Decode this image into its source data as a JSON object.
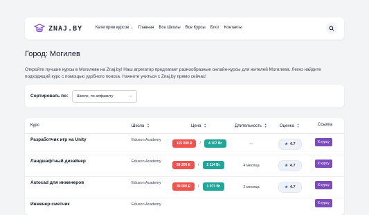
{
  "header": {
    "logo_text": "ZNAJ.BY",
    "nav": [
      {
        "label": "Категории курсов",
        "dropdown": true
      },
      {
        "label": "Главная"
      },
      {
        "label": "Все Школы"
      },
      {
        "label": "Все Курсы"
      },
      {
        "label": "Блог"
      },
      {
        "label": "Контакты"
      }
    ],
    "search_icon": "search-icon"
  },
  "page": {
    "title": "Город: Могилев",
    "intro": "Откройте лучшие курсы в Могилеве на Znaj.by! Наш агрегатор предлагает разнообразные онлайн-курсы для жителей Могилева. Легко найдите подходящий курс с помощью удобного поиска. Начните учиться с Znaj.by прямо сейчас!"
  },
  "sort": {
    "label": "Сортировать по:",
    "selected": "Школе, по алфавиту"
  },
  "table": {
    "columns": {
      "course": "Курс",
      "school": "Школа",
      "price": "Цена",
      "duration": "Длительность",
      "rating": "Оценка",
      "link": "Ссылка"
    },
    "rows": [
      {
        "course": "Разработчик игр на Unity",
        "school": "Eduson Academy",
        "price_rub": "115 000 ₽",
        "price_byn": "4 107 Br",
        "duration": "—",
        "rating": "4.7",
        "link": "К курсу"
      },
      {
        "course": "Ландшафтный дизайнер",
        "school": "Eduson Academy",
        "price_rub": "59 200 ₽",
        "price_byn": "2 114 Br",
        "duration": "4 месяца",
        "rating": "4.7",
        "link": "К курсу"
      },
      {
        "course": "Autocad для инженеров",
        "school": "Eduson Academy",
        "price_rub": "30 000 ₽",
        "price_byn": "1 071 Br",
        "duration": "2 месяца",
        "rating": "4.7",
        "link": "К курсу"
      },
      {
        "course": "Инженер-сметчик",
        "school": "Eduson Academy",
        "price_rub": "",
        "price_byn": "",
        "duration": "",
        "rating": "",
        "link": "К курсу"
      }
    ]
  },
  "colors": {
    "accent": "#7c4dba",
    "price_rub": "#ef5350",
    "price_byn": "#22a699",
    "star": "#1d4ed8"
  }
}
